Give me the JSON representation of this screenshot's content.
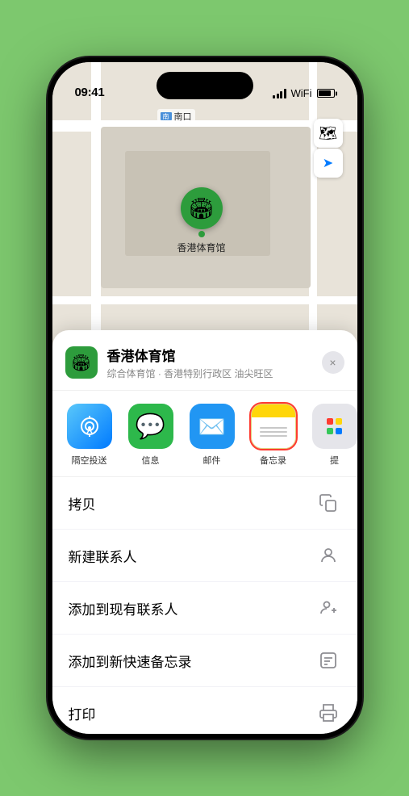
{
  "status_bar": {
    "time": "09:41",
    "location_icon": "▶"
  },
  "map": {
    "label_nankou": "南口",
    "venue_label": "香港体育馆",
    "venue_emoji": "🏟️"
  },
  "map_buttons": {
    "map_icon": "🗺",
    "location_icon": "➤"
  },
  "venue_card": {
    "name": "香港体育馆",
    "subtitle": "综合体育馆 · 香港特别行政区 油尖旺区",
    "close_label": "×"
  },
  "share_items": [
    {
      "id": "airdrop",
      "label": "隔空投送",
      "type": "airdrop"
    },
    {
      "id": "messages",
      "label": "信息",
      "type": "messages"
    },
    {
      "id": "mail",
      "label": "邮件",
      "type": "mail"
    },
    {
      "id": "notes",
      "label": "备忘录",
      "type": "notes",
      "selected": true
    },
    {
      "id": "more",
      "label": "提",
      "type": "more"
    }
  ],
  "actions": [
    {
      "id": "copy",
      "label": "拷贝",
      "icon": "copy"
    },
    {
      "id": "new-contact",
      "label": "新建联系人",
      "icon": "person"
    },
    {
      "id": "add-contact",
      "label": "添加到现有联系人",
      "icon": "person-add"
    },
    {
      "id": "quick-note",
      "label": "添加到新快速备忘录",
      "icon": "note"
    },
    {
      "id": "print",
      "label": "打印",
      "icon": "print"
    }
  ],
  "more_dots": {
    "colors": [
      "#ff3b30",
      "#ffd60a",
      "#34c759",
      "#007aff",
      "#af52de"
    ]
  }
}
